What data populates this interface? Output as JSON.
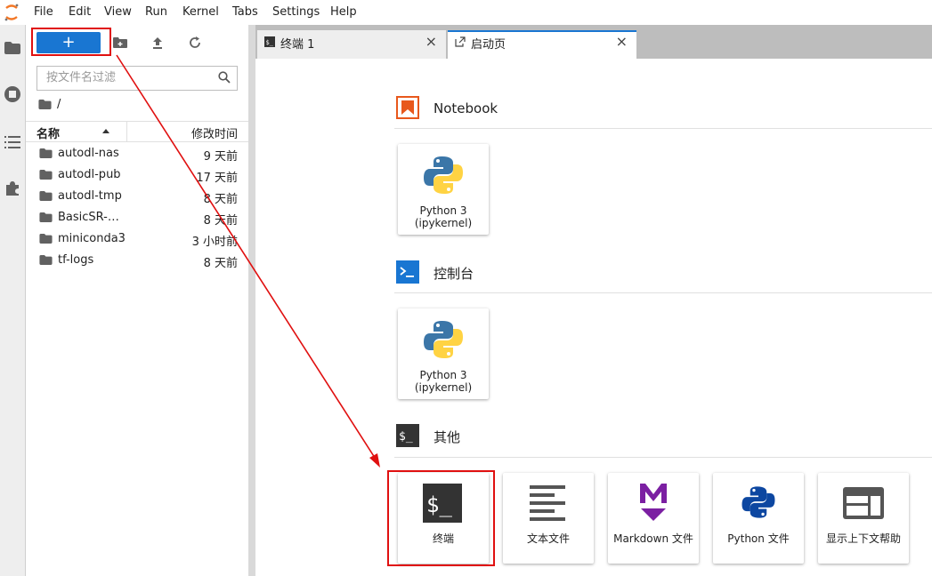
{
  "menubar": {
    "items": [
      "File",
      "Edit",
      "View",
      "Run",
      "Kernel",
      "Tabs",
      "Settings",
      "Help"
    ]
  },
  "activity": {
    "icons": [
      "folder-icon",
      "running-icon",
      "toc-icon",
      "extension-icon"
    ]
  },
  "filebrowser": {
    "new_label": "+",
    "filter_placeholder": "按文件名过滤",
    "breadcrumb": "/",
    "col_name": "名称",
    "col_modified": "修改时间",
    "files": [
      {
        "name": "autodl-nas",
        "modified": "9 天前"
      },
      {
        "name": "autodl-pub",
        "modified": "17 天前"
      },
      {
        "name": "autodl-tmp",
        "modified": "8 天前"
      },
      {
        "name": "BasicSR-…",
        "modified": "8 天前"
      },
      {
        "name": "miniconda3",
        "modified": "3 小时前"
      },
      {
        "name": "tf-logs",
        "modified": "8 天前"
      }
    ]
  },
  "tabs": [
    {
      "label": "终端 1",
      "close": "×"
    },
    {
      "label": "启动页",
      "close": "×"
    }
  ],
  "launcher": {
    "sections": [
      {
        "title": "Notebook",
        "cards": [
          {
            "label1": "Python 3",
            "label2": "(ipykernel)"
          }
        ]
      },
      {
        "title": "控制台",
        "cards": [
          {
            "label1": "Python 3",
            "label2": "(ipykernel)"
          }
        ]
      },
      {
        "title": "其他",
        "cards": [
          {
            "label1": "终端"
          },
          {
            "label1": "文本文件"
          },
          {
            "label1": "Markdown 文件"
          },
          {
            "label1": "Python 文件"
          },
          {
            "label1": "显示上下文帮助"
          }
        ]
      }
    ]
  },
  "colors": {
    "accent": "#1976d2",
    "annotation": "#e01010",
    "notebook_icon": "#e8581c",
    "markdown_icon": "#7b1fa2"
  }
}
